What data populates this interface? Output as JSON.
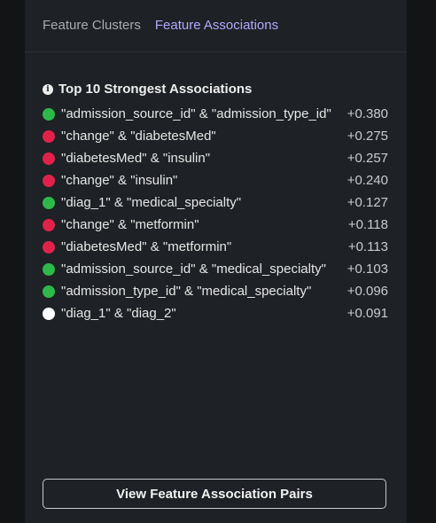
{
  "tabs": [
    {
      "label": "Feature Clusters",
      "active": false
    },
    {
      "label": "Feature Associations",
      "active": true
    }
  ],
  "section": {
    "title": "Top 10 Strongest Associations",
    "icon": "info-icon"
  },
  "colors": {
    "green": "#2eb84a",
    "red": "#e0224a",
    "white": "#ffffff",
    "accent": "#b3a8ff"
  },
  "associations": [
    {
      "pair": "\"admission_source_id\" & \"admission_type_id\"",
      "value": "+0.380",
      "color": "#2eb84a"
    },
    {
      "pair": "\"change\" & \"diabetesMed\"",
      "value": "+0.275",
      "color": "#e0224a"
    },
    {
      "pair": "\"diabetesMed\" & \"insulin\"",
      "value": "+0.257",
      "color": "#e0224a"
    },
    {
      "pair": "\"change\" & \"insulin\"",
      "value": "+0.240",
      "color": "#e0224a"
    },
    {
      "pair": "\"diag_1\" & \"medical_specialty\"",
      "value": "+0.127",
      "color": "#2eb84a"
    },
    {
      "pair": "\"change\" & \"metformin\"",
      "value": "+0.118",
      "color": "#e0224a"
    },
    {
      "pair": "\"diabetesMed\" & \"metformin\"",
      "value": "+0.113",
      "color": "#e0224a"
    },
    {
      "pair": "\"admission_source_id\" & \"medical_specialty\"",
      "value": "+0.103",
      "color": "#2eb84a"
    },
    {
      "pair": "\"admission_type_id\" & \"medical_specialty\"",
      "value": "+0.096",
      "color": "#2eb84a"
    },
    {
      "pair": "\"diag_1\" & \"diag_2\"",
      "value": "+0.091",
      "color": "#ffffff"
    }
  ],
  "button": {
    "label": "View Feature Association Pairs"
  }
}
